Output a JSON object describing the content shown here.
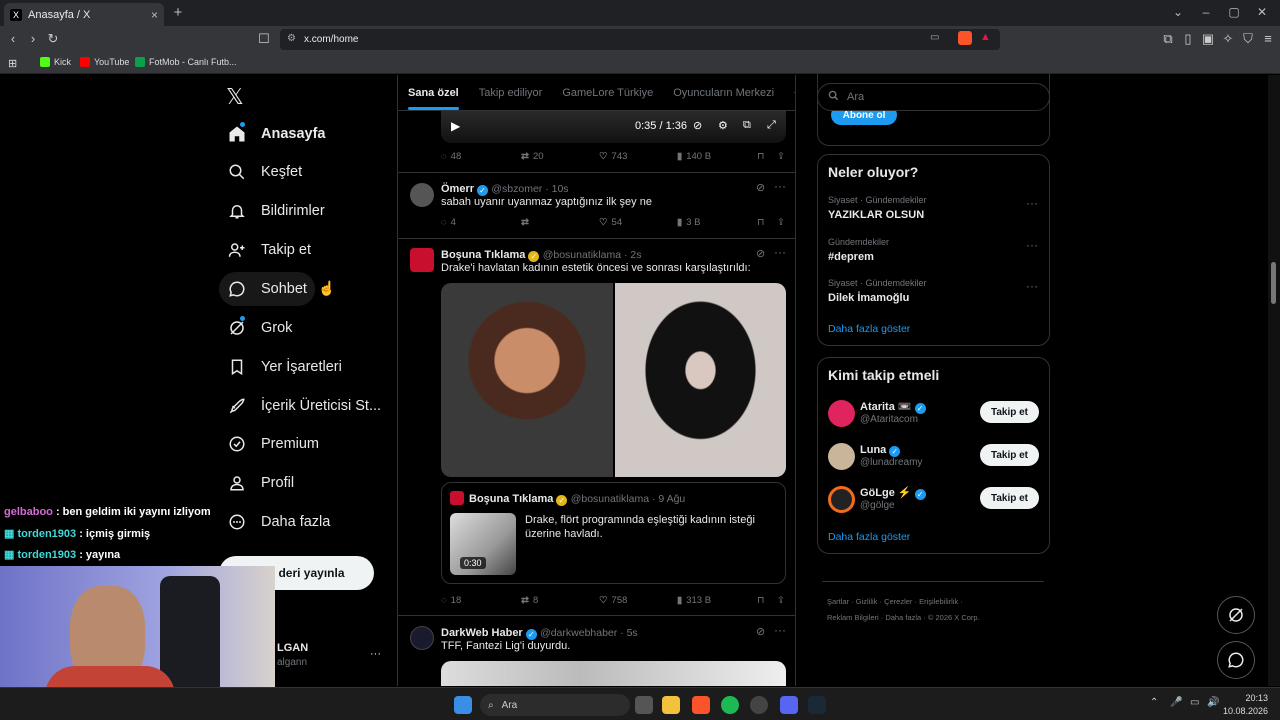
{
  "browser": {
    "tab_title": "Anasayfa / X",
    "tab_close": "×",
    "new_tab": "+",
    "url": "x.com/home",
    "bookmarks": [
      {
        "label": "Kick",
        "color": "#53fc18"
      },
      {
        "label": "YouTube",
        "color": "#ff0000"
      },
      {
        "label": "FotMob - Canlı Futb...",
        "color": "#0ba04c"
      }
    ]
  },
  "nav": {
    "logo": "𝕏",
    "items": [
      {
        "label": "Anasayfa",
        "icon": "home-icon"
      },
      {
        "label": "Keşfet",
        "icon": "search-icon"
      },
      {
        "label": "Bildirimler",
        "icon": "bell-icon"
      },
      {
        "label": "Takip et",
        "icon": "add-user-icon"
      },
      {
        "label": "Sohbet",
        "icon": "chat-icon"
      },
      {
        "label": "Grok",
        "icon": "grok-icon"
      },
      {
        "label": "Yer İşaretleri",
        "icon": "bookmark-icon"
      },
      {
        "label": "İçerik Üreticisi St...",
        "icon": "rocket-icon"
      },
      {
        "label": "Premium",
        "icon": "verified-icon"
      },
      {
        "label": "Profil",
        "icon": "person-icon"
      },
      {
        "label": "Daha fazla",
        "icon": "more-circle-icon"
      }
    ],
    "post_button": "deri yayınla",
    "account_name": "LGAN",
    "account_handle": "algann",
    "account_more": "···"
  },
  "feed_tabs": [
    "Sana özel",
    "Takip ediliyor",
    "GameLore Türkiye",
    "Oyuncuların Merkezi"
  ],
  "feed_tabs_add": "+",
  "video": {
    "time": "0:35 / 1:36"
  },
  "tweets": [
    {
      "stats": {
        "replies": "48",
        "retweets": "20",
        "likes": "743",
        "views": "140 B"
      }
    },
    {
      "name": "Ömerr",
      "handle": "@sbzomer · 10s",
      "text": "sabah uyanır uyanmaz yaptığınız ilk şey ne",
      "stats": {
        "replies": "4",
        "retweets": "",
        "likes": "54",
        "views": "3 B"
      }
    },
    {
      "name": "Boşuna Tıklama",
      "handle": "@bosunatiklama · 2s",
      "text": "Drake'i havlatan kadının estetik öncesi ve sonrası karşılaştırıldı:",
      "quote": {
        "name": "Boşuna Tıklama",
        "handle": "@bosunatiklama · 9 Ağu",
        "text": "Drake, flört programında eşleştiği kadının isteği üzerine havladı.",
        "duration": "0:30"
      },
      "stats": {
        "replies": "18",
        "retweets": "8",
        "likes": "758",
        "views": "313 B"
      }
    },
    {
      "name": "DarkWeb Haber",
      "handle": "@darkwebhaber · 5s",
      "text": "TFF, Fantezi Lig'i duyurdu."
    }
  ],
  "sidebar": {
    "search_placeholder": "Ara",
    "subscribe_button": "Abone ol",
    "trends_title": "Neler oluyor?",
    "trends": [
      {
        "sub": "Siyaset · Gündemdekiler",
        "title": "YAZIKLAR OLSUN"
      },
      {
        "sub": "Gündemdekiler",
        "title": "#deprem"
      },
      {
        "sub": "Siyaset · Gündemdekiler",
        "title": "Dilek İmamoğlu"
      }
    ],
    "show_more": "Daha fazla göster",
    "who_title": "Kimi takip etmeli",
    "who": [
      {
        "name": "Atarita 📼",
        "handle": "@Ataritacom",
        "button": "Takip et",
        "color": "#e0245e"
      },
      {
        "name": "Luna",
        "handle": "@lunadreamy",
        "button": "Takip et",
        "color": "#c9b59a"
      },
      {
        "name": "GöLge ⚡",
        "handle": "@gölge",
        "button": "Takip et",
        "color": "#f26b1d"
      }
    ],
    "footer_row1": "Şartlar  ·  Gizlilik  ·  Çerezler  ·  Erişilebilirlik  ·",
    "footer_row2": "Reklam Bilgileri  ·  Daha fazla  ·  © 2026 X Corp."
  },
  "chat": [
    {
      "user": "gelbaboo",
      "msg": " : ben geldim iki yayını izliyom",
      "color": "#d66bd6"
    },
    {
      "user": "torden1903",
      "msg": " : içmiş girmiş",
      "color": "#3fd9d9"
    },
    {
      "user": "torden1903",
      "msg": " : yayına",
      "color": "#3fd9d9"
    }
  ],
  "taskbar": {
    "search": "Ara",
    "time": "20:13",
    "date": "10.08.2026"
  }
}
